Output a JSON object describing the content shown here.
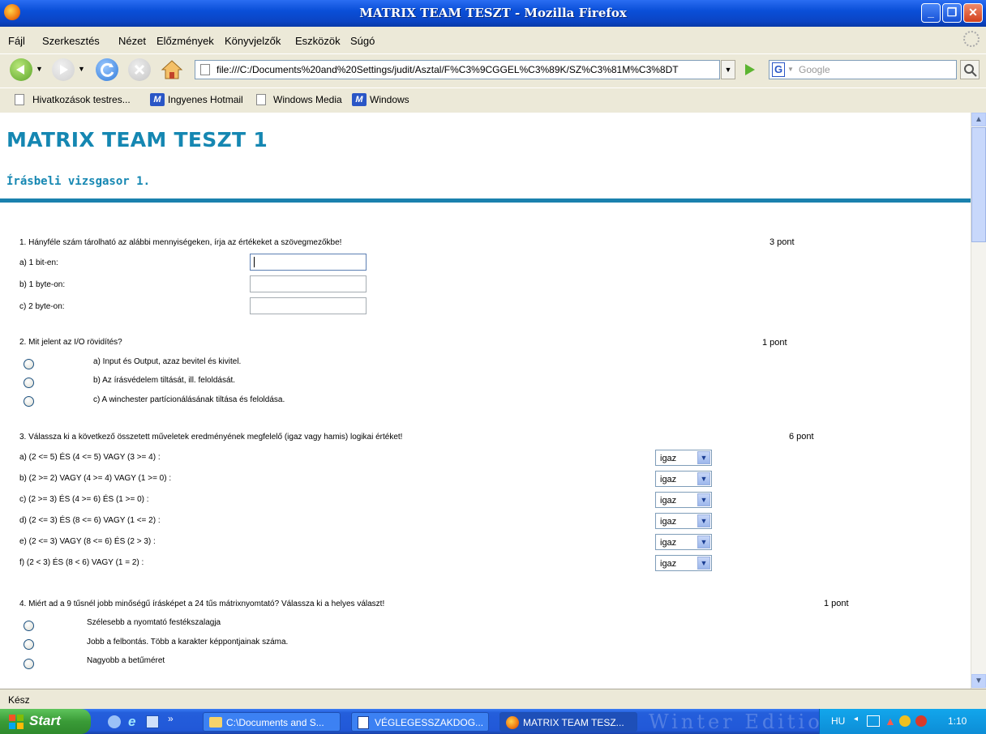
{
  "window": {
    "title": "MATRIX TEAM TESZT - Mozilla Firefox"
  },
  "menu": [
    "Fájl",
    "Szerkesztés",
    "Nézet",
    "Előzmények",
    "Könyvjelzők",
    "Eszközök",
    "Súgó"
  ],
  "nav": {
    "url": "file:///C:/Documents%20and%20Settings/judit/Asztal/F%C3%9CGGEL%C3%89K/SZ%C3%81M%C3%8DT",
    "search_placeholder": "Google",
    "search_engine_label": "G"
  },
  "bookmarks": [
    {
      "label": "Hivatkozások testres...",
      "icon": "page-icon"
    },
    {
      "label": "Ingyenes Hotmail",
      "icon": "msn-icon"
    },
    {
      "label": "Windows Media",
      "icon": "page-icon"
    },
    {
      "label": "Windows",
      "icon": "msn-icon"
    }
  ],
  "page": {
    "title": "MATRIX TEAM TESZT 1",
    "subtitle": "Írásbeli vizsgasor 1.",
    "q1": {
      "text": "1. Hányféle szám tárolható az alábbi mennyiségeken, írja az értékeket a szövegmezőkbe!",
      "points": "3 pont",
      "items": [
        "a) 1 bit-en:",
        "b) 1 byte-on:",
        "c) 2 byte-on:"
      ]
    },
    "q2": {
      "text": "2. Mit jelent az I/O rövidítés?",
      "points": "1 pont",
      "options": [
        "a) Input és Output, azaz bevitel és kivitel.",
        "b) Az írásvédelem tiltását, ill. feloldását.",
        "c) A winchester partícionálásának tiltása és feloldása."
      ]
    },
    "q3": {
      "text": "3. Válassza ki a következő összetett műveletek eredményének megfelelő (igaz vagy hamis) logikai értéket!",
      "points": "6 pont",
      "items": [
        {
          "label": "a) (2 <= 5) ÉS (4 <= 5) VAGY (3 >= 4) :",
          "value": "igaz"
        },
        {
          "label": "b) (2 >= 2) VAGY (4 >= 4) VAGY (1 >= 0) :",
          "value": "igaz"
        },
        {
          "label": "c) (2 >= 3) ÉS (4 >= 6) ÉS (1 >= 0) :",
          "value": "igaz"
        },
        {
          "label": "d) (2 <= 3) ÉS (8 <= 6) VAGY (1 <= 2) :",
          "value": "igaz"
        },
        {
          "label": "e) (2 <= 3) VAGY (8 <= 6) ÉS (2 > 3) :",
          "value": "igaz"
        },
        {
          "label": "f) (2 < 3) ÉS (8 < 6) VAGY (1 = 2) :",
          "value": "igaz"
        }
      ]
    },
    "q4": {
      "text": "4. Miért ad a 9 tűsnél jobb minőségű írásképet a 24 tűs mátrixnyomtató? Válassza ki a helyes választ!",
      "points": "1 pont",
      "options": [
        "Szélesebb a nyomtató festékszalagja",
        "Jobb a felbontás. Több a karakter képpontjainak száma.",
        "Nagyobb a betűméret"
      ]
    }
  },
  "status": "Kész",
  "taskbar": {
    "start": "Start",
    "items": [
      {
        "label": "C:\\Documents and S...",
        "active": false
      },
      {
        "label": "VÉGLEGESSZAKDOG...",
        "active": false
      },
      {
        "label": "MATRIX TEAM TESZ...",
        "active": true
      }
    ],
    "watermark": "Winter Edition",
    "lang": "HU",
    "time": "1:10"
  },
  "colors": {
    "heading": "#1587b2",
    "rule": "#1a81ae",
    "titlebar": "#0a4fd8",
    "taskbar": "#245edb",
    "start": "#3a9b37"
  }
}
